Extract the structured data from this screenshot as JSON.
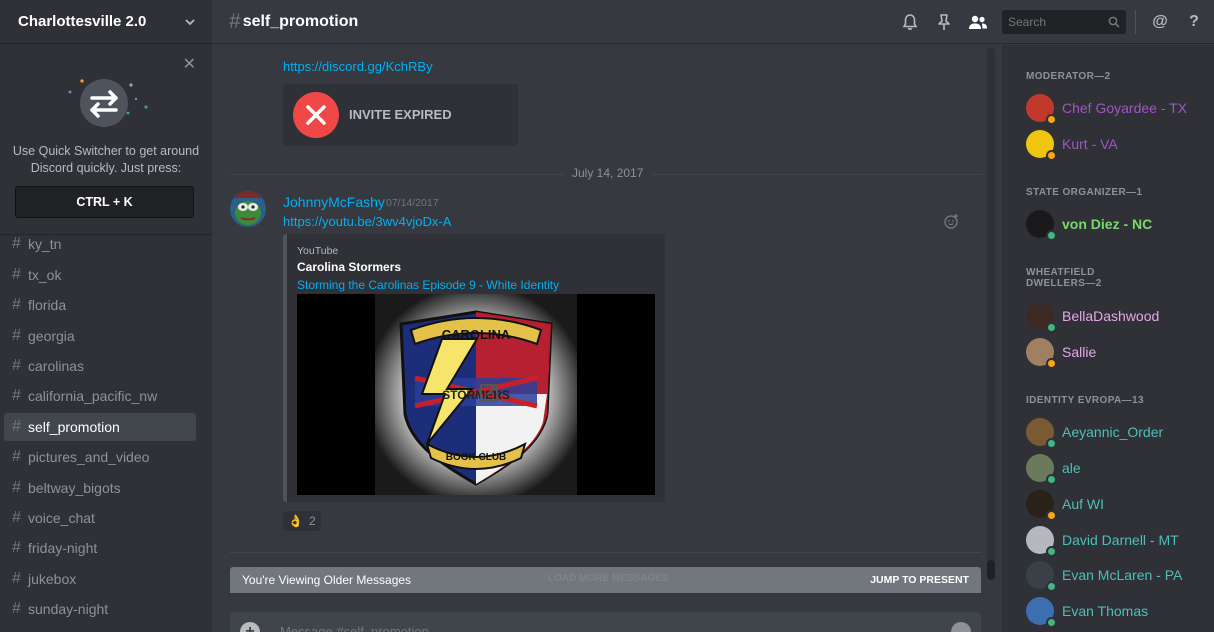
{
  "server": {
    "name": "Charlottesville 2.0"
  },
  "quick_switcher": {
    "text": "Use Quick Switcher to get around Discord quickly. Just press:",
    "shortcut": "CTRL + K"
  },
  "channels": [
    {
      "name": "ky_tn",
      "active": false
    },
    {
      "name": "tx_ok",
      "active": false
    },
    {
      "name": "florida",
      "active": false
    },
    {
      "name": "georgia",
      "active": false
    },
    {
      "name": "carolinas",
      "active": false
    },
    {
      "name": "california_pacific_nw",
      "active": false
    },
    {
      "name": "self_promotion",
      "active": true
    },
    {
      "name": "pictures_and_video",
      "active": false
    },
    {
      "name": "beltway_bigots",
      "active": false
    },
    {
      "name": "voice_chat",
      "active": false
    },
    {
      "name": "friday-night",
      "active": false
    },
    {
      "name": "jukebox",
      "active": false
    },
    {
      "name": "sunday-night",
      "active": false
    }
  ],
  "topbar": {
    "hash": "#",
    "channel": "self_promotion",
    "search_placeholder": "Search"
  },
  "messages": {
    "previous_link": "https://discord.gg/KchRBy",
    "invite_status": "INVITE EXPIRED",
    "date_divider": "July 14, 2017",
    "author": "JohnnyMcFashy",
    "timestamp": "07/14/2017",
    "link": "https://youtu.be/3wv4vjoDx-A",
    "embed": {
      "provider": "YouTube",
      "author": "Carolina Stormers",
      "title": "Storming the Carolinas Episode 9 - White Identity",
      "badge_top": "CAROLINA",
      "badge_mid": "STORMERS",
      "badge_bottom": "BOOK CLUB"
    },
    "reaction": {
      "emoji": "👌",
      "count": "2"
    }
  },
  "older_bar": {
    "text": "You're Viewing Older Messages",
    "load_more": "LOAD MORE MESSAGES",
    "jump": "JUMP TO PRESENT"
  },
  "composer": {
    "placeholder": "Message #self_promotion"
  },
  "member_groups": [
    {
      "title": "MODERATOR—2",
      "members": [
        {
          "name": "Chef Goyardee - TX",
          "color": "#a155c4",
          "status": "#faa61a",
          "avatar": "#c0392b"
        },
        {
          "name": "Kurt - VA",
          "color": "#a155c4",
          "status": "#faa61a",
          "avatar": "#f1c40f"
        }
      ]
    },
    {
      "title": "STATE ORGANIZER—1",
      "members": [
        {
          "name": "von Diez - NC",
          "color": "#7bd96b",
          "status": "#43b581",
          "avatar": "#1a1a1a"
        }
      ]
    },
    {
      "title": "WHEATFIELD DWELLERS—2",
      "members": [
        {
          "name": "BellaDashwood",
          "color": "#e6a6e8",
          "status": "#43b581",
          "avatar": "#3b2a24"
        },
        {
          "name": "Sallie",
          "color": "#e6a6e8",
          "status": "#faa61a",
          "avatar": "#a08060"
        }
      ]
    },
    {
      "title": "IDENTITY EVROPA—13",
      "members": [
        {
          "name": "Aeyannic_Order",
          "color": "#4fbfb9",
          "status": "#43b581",
          "avatar": "#7a5a32"
        },
        {
          "name": "ale",
          "color": "#4fbfb9",
          "status": "#43b581",
          "avatar": "#6b7a5a"
        },
        {
          "name": "Auf WI",
          "color": "#4fbfb9",
          "status": "#faa61a",
          "avatar": "#2a2218"
        },
        {
          "name": "David Darnell - MT",
          "color": "#4fbfb9",
          "status": "#43b581",
          "avatar": "#b5b8bc"
        },
        {
          "name": "Evan McLaren - PA",
          "color": "#4fbfb9",
          "status": "#43b581",
          "avatar": "#3a4048"
        },
        {
          "name": "Evan Thomas",
          "color": "#4fbfb9",
          "status": "#43b581",
          "avatar": "#3b6fb0"
        }
      ]
    }
  ]
}
